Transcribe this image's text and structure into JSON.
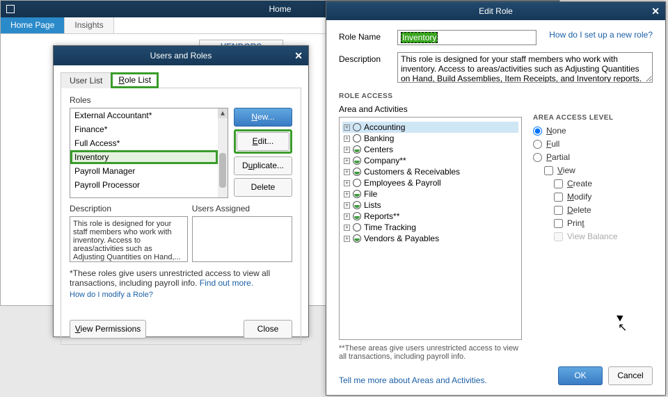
{
  "app": {
    "title": "Home",
    "tabs": [
      "Home Page",
      "Insights"
    ],
    "active_tab": 0,
    "vendors": "VENDORS"
  },
  "dlg1": {
    "title": "Users and Roles",
    "tabs": {
      "user": "User List",
      "role": "Role List",
      "role_underline": "R"
    },
    "roles_label": "Roles",
    "items": [
      "External Accountant*",
      "Finance*",
      "Full Access*",
      "Inventory",
      "Payroll Manager",
      "Payroll Processor"
    ],
    "selected_index": 3,
    "buttons": {
      "new": "New...",
      "edit": "Edit...",
      "dup": "Duplicate...",
      "del": "Delete"
    },
    "desc_label": "Description",
    "assigned_label": "Users Assigned",
    "desc_text": "This role is designed for your staff members who work with inventory. Access to areas/activities such as Adjusting Quantities on Hand,...",
    "note_prefix": "*These roles give users unrestricted access to view all transactions, including payroll info. ",
    "note_link": "Find out more.",
    "modify_link": "How do I modify a Role?",
    "view_perm": "View Permissions",
    "close": "Close"
  },
  "dlg2": {
    "title": "Edit Role",
    "role_name_label": "Role Name",
    "role_name_value": "Inventory",
    "setup_link": "How do I set up a new role?",
    "desc_label": "Description",
    "desc_text": "This role is designed for your staff members who work with inventory. Access to areas/activities such as Adjusting Quantities on Hand, Build Assemblies, Item Receipts, and Inventory reports.",
    "section": "ROLE ACCESS",
    "area_label": "Area and Activities",
    "tree": [
      {
        "label": "Accounting",
        "fill": "none",
        "sel": true
      },
      {
        "label": "Banking",
        "fill": "none"
      },
      {
        "label": "Centers",
        "fill": "half"
      },
      {
        "label": "Company**",
        "fill": "half"
      },
      {
        "label": "Customers & Receivables",
        "fill": "half"
      },
      {
        "label": "Employees & Payroll",
        "fill": "none"
      },
      {
        "label": "File",
        "fill": "half"
      },
      {
        "label": "Lists",
        "fill": "half"
      },
      {
        "label": "Reports**",
        "fill": "half"
      },
      {
        "label": "Time Tracking",
        "fill": "none"
      },
      {
        "label": "Vendors & Payables",
        "fill": "half"
      }
    ],
    "tree_note": "**These areas give users unrestricted access to view all transactions, including payroll info.",
    "access_header": "AREA ACCESS LEVEL",
    "radios": {
      "none": "None",
      "full": "Full",
      "partial": "Partial"
    },
    "selected_radio": "none",
    "checks": {
      "view": "View",
      "create": "Create",
      "modify": "Modify",
      "delete": "Delete",
      "print": "Print",
      "balance": "View Balance"
    },
    "tell_link": "Tell me more about Areas and Activities.",
    "ok": "OK",
    "cancel": "Cancel"
  }
}
